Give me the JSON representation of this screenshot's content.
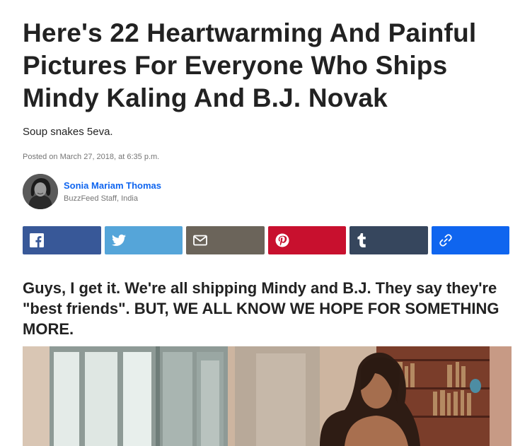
{
  "article": {
    "headline": "Here's 22 Heartwarming And Painful Pictures For Everyone Who Ships Mindy Kaling And B.J. Novak",
    "dek": "Soup snakes 5eva.",
    "posted": "Posted on March 27, 2018, at 6:35 p.m.",
    "lead": "Guys, I get it. We're all shipping Mindy and B.J. They say they're \"best friends\". BUT, WE ALL KNOW WE HOPE FOR SOMETHING MORE."
  },
  "author": {
    "name": "Sonia Mariam Thomas",
    "title": "BuzzFeed Staff, India"
  },
  "share": {
    "buttons": [
      {
        "name": "facebook",
        "icon": "facebook-icon",
        "color": "#385898"
      },
      {
        "name": "twitter",
        "icon": "twitter-icon",
        "color": "#55a5d9"
      },
      {
        "name": "email",
        "icon": "mail-icon",
        "color": "#6b645a"
      },
      {
        "name": "pinterest",
        "icon": "pinterest-icon",
        "color": "#c8102e"
      },
      {
        "name": "tumblr",
        "icon": "tumblr-icon",
        "color": "#36465d"
      },
      {
        "name": "copy-link",
        "icon": "link-icon",
        "color": "#0f65ef"
      }
    ]
  }
}
